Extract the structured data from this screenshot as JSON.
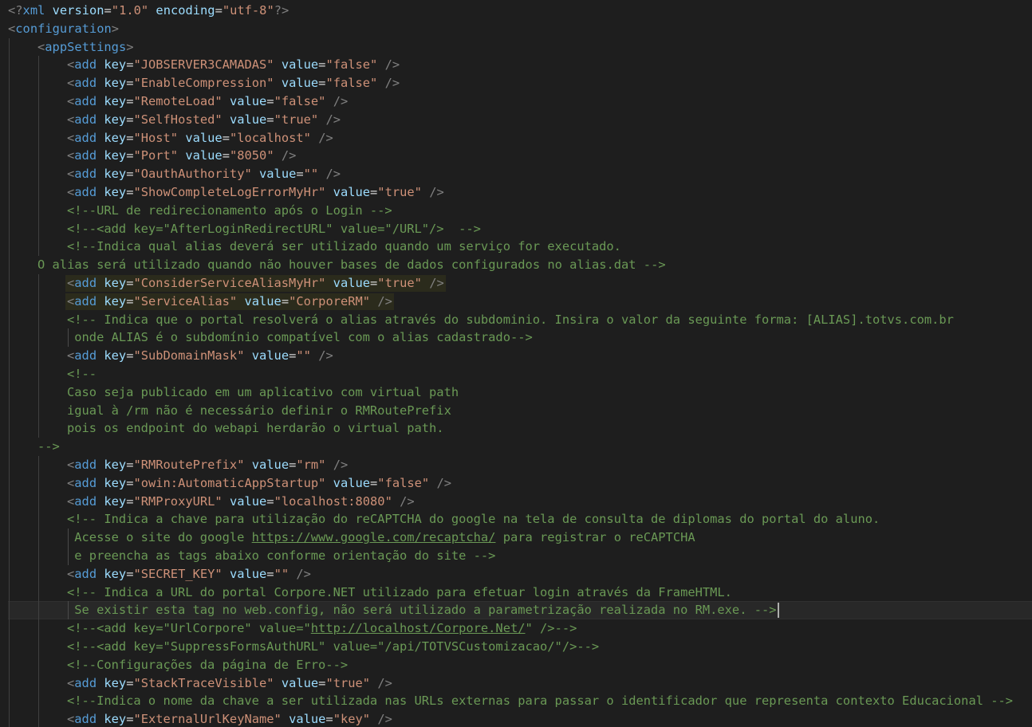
{
  "editor": {
    "language": "xml",
    "colors": {
      "background": "#1e1e1e",
      "bracket": "#808080",
      "tag": "#569cd6",
      "attribute": "#9cdcfe",
      "string": "#ce9178",
      "comment": "#6a9955",
      "text": "#d4d4d4"
    },
    "lines": [
      {
        "indent": 0,
        "tokens": [
          [
            "br",
            "<?"
          ],
          [
            "tag",
            "xml"
          ],
          [
            "txt",
            " "
          ],
          [
            "attr",
            "version"
          ],
          [
            "eq",
            "="
          ],
          [
            "str",
            "\"1.0\""
          ],
          [
            "txt",
            " "
          ],
          [
            "attr",
            "encoding"
          ],
          [
            "eq",
            "="
          ],
          [
            "str",
            "\"utf-8\""
          ],
          [
            "br",
            "?>"
          ]
        ]
      },
      {
        "indent": 0,
        "tokens": [
          [
            "br",
            "<"
          ],
          [
            "tag",
            "configuration"
          ],
          [
            "br",
            ">"
          ]
        ]
      },
      {
        "indent": 1,
        "tokens": [
          [
            "br",
            "<"
          ],
          [
            "tag",
            "appSettings"
          ],
          [
            "br",
            ">"
          ]
        ]
      },
      {
        "indent": 2,
        "tokens": [
          [
            "br",
            "<"
          ],
          [
            "tag",
            "add"
          ],
          [
            "txt",
            " "
          ],
          [
            "attr",
            "key"
          ],
          [
            "eq",
            "="
          ],
          [
            "str",
            "\"JOBSERVER3CAMADAS\""
          ],
          [
            "txt",
            " "
          ],
          [
            "attr",
            "value"
          ],
          [
            "eq",
            "="
          ],
          [
            "str",
            "\"false\""
          ],
          [
            "txt",
            " "
          ],
          [
            "br",
            "/>"
          ]
        ]
      },
      {
        "indent": 2,
        "tokens": [
          [
            "br",
            "<"
          ],
          [
            "tag",
            "add"
          ],
          [
            "txt",
            " "
          ],
          [
            "attr",
            "key"
          ],
          [
            "eq",
            "="
          ],
          [
            "str",
            "\"EnableCompression\""
          ],
          [
            "txt",
            " "
          ],
          [
            "attr",
            "value"
          ],
          [
            "eq",
            "="
          ],
          [
            "str",
            "\"false\""
          ],
          [
            "txt",
            " "
          ],
          [
            "br",
            "/>"
          ]
        ]
      },
      {
        "indent": 2,
        "tokens": [
          [
            "br",
            "<"
          ],
          [
            "tag",
            "add"
          ],
          [
            "txt",
            " "
          ],
          [
            "attr",
            "key"
          ],
          [
            "eq",
            "="
          ],
          [
            "str",
            "\"RemoteLoad\""
          ],
          [
            "txt",
            " "
          ],
          [
            "attr",
            "value"
          ],
          [
            "eq",
            "="
          ],
          [
            "str",
            "\"false\""
          ],
          [
            "txt",
            " "
          ],
          [
            "br",
            "/>"
          ]
        ]
      },
      {
        "indent": 2,
        "tokens": [
          [
            "br",
            "<"
          ],
          [
            "tag",
            "add"
          ],
          [
            "txt",
            " "
          ],
          [
            "attr",
            "key"
          ],
          [
            "eq",
            "="
          ],
          [
            "str",
            "\"SelfHosted\""
          ],
          [
            "txt",
            " "
          ],
          [
            "attr",
            "value"
          ],
          [
            "eq",
            "="
          ],
          [
            "str",
            "\"true\""
          ],
          [
            "txt",
            " "
          ],
          [
            "br",
            "/>"
          ]
        ]
      },
      {
        "indent": 2,
        "tokens": [
          [
            "br",
            "<"
          ],
          [
            "tag",
            "add"
          ],
          [
            "txt",
            " "
          ],
          [
            "attr",
            "key"
          ],
          [
            "eq",
            "="
          ],
          [
            "str",
            "\"Host\""
          ],
          [
            "txt",
            " "
          ],
          [
            "attr",
            "value"
          ],
          [
            "eq",
            "="
          ],
          [
            "str",
            "\"localhost\""
          ],
          [
            "txt",
            " "
          ],
          [
            "br",
            "/>"
          ]
        ]
      },
      {
        "indent": 2,
        "tokens": [
          [
            "br",
            "<"
          ],
          [
            "tag",
            "add"
          ],
          [
            "txt",
            " "
          ],
          [
            "attr",
            "key"
          ],
          [
            "eq",
            "="
          ],
          [
            "str",
            "\"Port\""
          ],
          [
            "txt",
            " "
          ],
          [
            "attr",
            "value"
          ],
          [
            "eq",
            "="
          ],
          [
            "str",
            "\"8050\""
          ],
          [
            "txt",
            " "
          ],
          [
            "br",
            "/>"
          ]
        ]
      },
      {
        "indent": 2,
        "tokens": [
          [
            "br",
            "<"
          ],
          [
            "tag",
            "add"
          ],
          [
            "txt",
            " "
          ],
          [
            "attr",
            "key"
          ],
          [
            "eq",
            "="
          ],
          [
            "str",
            "\"OauthAuthority\""
          ],
          [
            "txt",
            " "
          ],
          [
            "attr",
            "value"
          ],
          [
            "eq",
            "="
          ],
          [
            "str",
            "\"\""
          ],
          [
            "txt",
            " "
          ],
          [
            "br",
            "/>"
          ]
        ]
      },
      {
        "indent": 2,
        "tokens": [
          [
            "br",
            "<"
          ],
          [
            "tag",
            "add"
          ],
          [
            "txt",
            " "
          ],
          [
            "attr",
            "key"
          ],
          [
            "eq",
            "="
          ],
          [
            "str",
            "\"ShowCompleteLogErrorMyHr\""
          ],
          [
            "txt",
            " "
          ],
          [
            "attr",
            "value"
          ],
          [
            "eq",
            "="
          ],
          [
            "str",
            "\"true\""
          ],
          [
            "txt",
            " "
          ],
          [
            "br",
            "/>"
          ]
        ]
      },
      {
        "indent": 2,
        "tokens": [
          [
            "cm",
            "<!--URL de redirecionamento após o Login -->"
          ]
        ]
      },
      {
        "indent": 2,
        "tokens": [
          [
            "cm",
            "<!--<add key=\"AfterLoginRedirectURL\" value=\"/URL\"/>  -->"
          ]
        ]
      },
      {
        "indent": 2,
        "tokens": [
          [
            "cm",
            "<!--Indica qual alias deverá ser utilizado quando um serviço for executado."
          ]
        ]
      },
      {
        "indent": 1,
        "tokens": [
          [
            "cm",
            "O alias será utilizado quando não houver bases de dados configurados no alias.dat -->"
          ]
        ]
      },
      {
        "indent": 2,
        "highlight": "soft",
        "tokens": [
          [
            "br",
            "<"
          ],
          [
            "tag",
            "add"
          ],
          [
            "txt",
            " "
          ],
          [
            "attr",
            "key"
          ],
          [
            "eq",
            "="
          ],
          [
            "str",
            "\"ConsiderServiceAliasMyHr\""
          ],
          [
            "txt",
            " "
          ],
          [
            "attr",
            "value"
          ],
          [
            "eq",
            "="
          ],
          [
            "str",
            "\"true\""
          ],
          [
            "txt",
            " "
          ],
          [
            "br",
            "/>"
          ]
        ]
      },
      {
        "indent": 2,
        "highlight": "soft",
        "tokens": [
          [
            "br",
            "<"
          ],
          [
            "tag",
            "add"
          ],
          [
            "txt",
            " "
          ],
          [
            "attr",
            "key"
          ],
          [
            "eq",
            "="
          ],
          [
            "str",
            "\"ServiceAlias\""
          ],
          [
            "txt",
            " "
          ],
          [
            "attr",
            "value"
          ],
          [
            "eq",
            "="
          ],
          [
            "str",
            "\"CorporeRM\""
          ],
          [
            "txt",
            " "
          ],
          [
            "br",
            "/>"
          ]
        ]
      },
      {
        "indent": 2,
        "tokens": [
          [
            "cm",
            "<!-- Indica que o portal resolverá o alias através do subdominio. Insira o valor da seguinte forma: [ALIAS].totvs.com.br"
          ]
        ]
      },
      {
        "indent": 2,
        "guide3": true,
        "tokens": [
          [
            "cm",
            " onde ALIAS é o subdomínio compatível com o alias cadastrado-->"
          ]
        ]
      },
      {
        "indent": 2,
        "tokens": [
          [
            "br",
            "<"
          ],
          [
            "tag",
            "add"
          ],
          [
            "txt",
            " "
          ],
          [
            "attr",
            "key"
          ],
          [
            "eq",
            "="
          ],
          [
            "str",
            "\"SubDomainMask\""
          ],
          [
            "txt",
            " "
          ],
          [
            "attr",
            "value"
          ],
          [
            "eq",
            "="
          ],
          [
            "str",
            "\"\""
          ],
          [
            "txt",
            " "
          ],
          [
            "br",
            "/>"
          ]
        ]
      },
      {
        "indent": 2,
        "tokens": [
          [
            "cm",
            "<!--"
          ]
        ]
      },
      {
        "indent": 2,
        "tokens": [
          [
            "cm",
            "Caso seja publicado em um aplicativo com virtual path"
          ]
        ]
      },
      {
        "indent": 2,
        "tokens": [
          [
            "cm",
            "igual à /rm não é necessário definir o RMRoutePrefix"
          ]
        ]
      },
      {
        "indent": 2,
        "tokens": [
          [
            "cm",
            "pois os endpoint do webapi herdarão o virtual path."
          ]
        ]
      },
      {
        "indent": 1,
        "tokens": [
          [
            "cm",
            "-->"
          ]
        ]
      },
      {
        "indent": 2,
        "tokens": [
          [
            "br",
            "<"
          ],
          [
            "tag",
            "add"
          ],
          [
            "txt",
            " "
          ],
          [
            "attr",
            "key"
          ],
          [
            "eq",
            "="
          ],
          [
            "str",
            "\"RMRoutePrefix\""
          ],
          [
            "txt",
            " "
          ],
          [
            "attr",
            "value"
          ],
          [
            "eq",
            "="
          ],
          [
            "str",
            "\"rm\""
          ],
          [
            "txt",
            " "
          ],
          [
            "br",
            "/>"
          ]
        ]
      },
      {
        "indent": 2,
        "tokens": [
          [
            "br",
            "<"
          ],
          [
            "tag",
            "add"
          ],
          [
            "txt",
            " "
          ],
          [
            "attr",
            "key"
          ],
          [
            "eq",
            "="
          ],
          [
            "str",
            "\"owin:AutomaticAppStartup\""
          ],
          [
            "txt",
            " "
          ],
          [
            "attr",
            "value"
          ],
          [
            "eq",
            "="
          ],
          [
            "str",
            "\"false\""
          ],
          [
            "txt",
            " "
          ],
          [
            "br",
            "/>"
          ]
        ]
      },
      {
        "indent": 2,
        "tokens": [
          [
            "br",
            "<"
          ],
          [
            "tag",
            "add"
          ],
          [
            "txt",
            " "
          ],
          [
            "attr",
            "key"
          ],
          [
            "eq",
            "="
          ],
          [
            "str",
            "\"RMProxyURL\""
          ],
          [
            "txt",
            " "
          ],
          [
            "attr",
            "value"
          ],
          [
            "eq",
            "="
          ],
          [
            "str",
            "\"localhost:8080\""
          ],
          [
            "txt",
            " "
          ],
          [
            "br",
            "/>"
          ]
        ]
      },
      {
        "indent": 2,
        "tokens": [
          [
            "cm",
            "<!-- Indica a chave para utilização do reCAPTCHA do google na tela de consulta de diplomas do portal do aluno."
          ]
        ]
      },
      {
        "indent": 2,
        "guide3": true,
        "tokens": [
          [
            "cm",
            " Acesse o site do google "
          ],
          [
            "cmlink",
            "https://www.google.com/recaptcha/"
          ],
          [
            "cm",
            " para registrar o reCAPTCHA"
          ]
        ]
      },
      {
        "indent": 2,
        "guide3": true,
        "tokens": [
          [
            "cm",
            " e preencha as tags abaixo conforme orientação do site -->"
          ]
        ]
      },
      {
        "indent": 2,
        "tokens": [
          [
            "br",
            "<"
          ],
          [
            "tag",
            "add"
          ],
          [
            "txt",
            " "
          ],
          [
            "attr",
            "key"
          ],
          [
            "eq",
            "="
          ],
          [
            "str",
            "\"SECRET_KEY\""
          ],
          [
            "txt",
            " "
          ],
          [
            "attr",
            "value"
          ],
          [
            "eq",
            "="
          ],
          [
            "str",
            "\"\""
          ],
          [
            "txt",
            " "
          ],
          [
            "br",
            "/>"
          ]
        ]
      },
      {
        "indent": 2,
        "tokens": [
          [
            "cm",
            "<!-- Indica a URL do portal Corpore.NET utilizado para efetuar login através da FrameHTML."
          ]
        ]
      },
      {
        "indent": 2,
        "guide3": true,
        "highlight": "current",
        "cursor": true,
        "tokens": [
          [
            "cm",
            " Se existir esta tag no web.config, não será utilizado a parametrização realizada no RM.exe. -->"
          ]
        ]
      },
      {
        "indent": 2,
        "tokens": [
          [
            "cm",
            "<!--<add key=\"UrlCorpore\" value=\""
          ],
          [
            "cmlink",
            "http://localhost/Corpore.Net/"
          ],
          [
            "cm",
            "\" />-->"
          ]
        ]
      },
      {
        "indent": 2,
        "tokens": [
          [
            "cm",
            "<!--<add key=\"SuppressFormsAuthURL\" value=\"/api/TOTVSCustomizacao/\"/>-->"
          ]
        ]
      },
      {
        "indent": 2,
        "tokens": [
          [
            "cm",
            "<!--Configurações da página de Erro-->"
          ]
        ]
      },
      {
        "indent": 2,
        "tokens": [
          [
            "br",
            "<"
          ],
          [
            "tag",
            "add"
          ],
          [
            "txt",
            " "
          ],
          [
            "attr",
            "key"
          ],
          [
            "eq",
            "="
          ],
          [
            "str",
            "\"StackTraceVisible\""
          ],
          [
            "txt",
            " "
          ],
          [
            "attr",
            "value"
          ],
          [
            "eq",
            "="
          ],
          [
            "str",
            "\"true\""
          ],
          [
            "txt",
            " "
          ],
          [
            "br",
            "/>"
          ]
        ]
      },
      {
        "indent": 2,
        "tokens": [
          [
            "cm",
            "<!--Indica o nome da chave a ser utilizada nas URLs externas para passar o identificador que representa contexto Educacional -->"
          ]
        ]
      },
      {
        "indent": 2,
        "tokens": [
          [
            "br",
            "<"
          ],
          [
            "tag",
            "add"
          ],
          [
            "txt",
            " "
          ],
          [
            "attr",
            "key"
          ],
          [
            "eq",
            "="
          ],
          [
            "str",
            "\"ExternalUrlKeyName\""
          ],
          [
            "txt",
            " "
          ],
          [
            "attr",
            "value"
          ],
          [
            "eq",
            "="
          ],
          [
            "str",
            "\"key\""
          ],
          [
            "txt",
            " "
          ],
          [
            "br",
            "/>"
          ]
        ]
      }
    ]
  }
}
